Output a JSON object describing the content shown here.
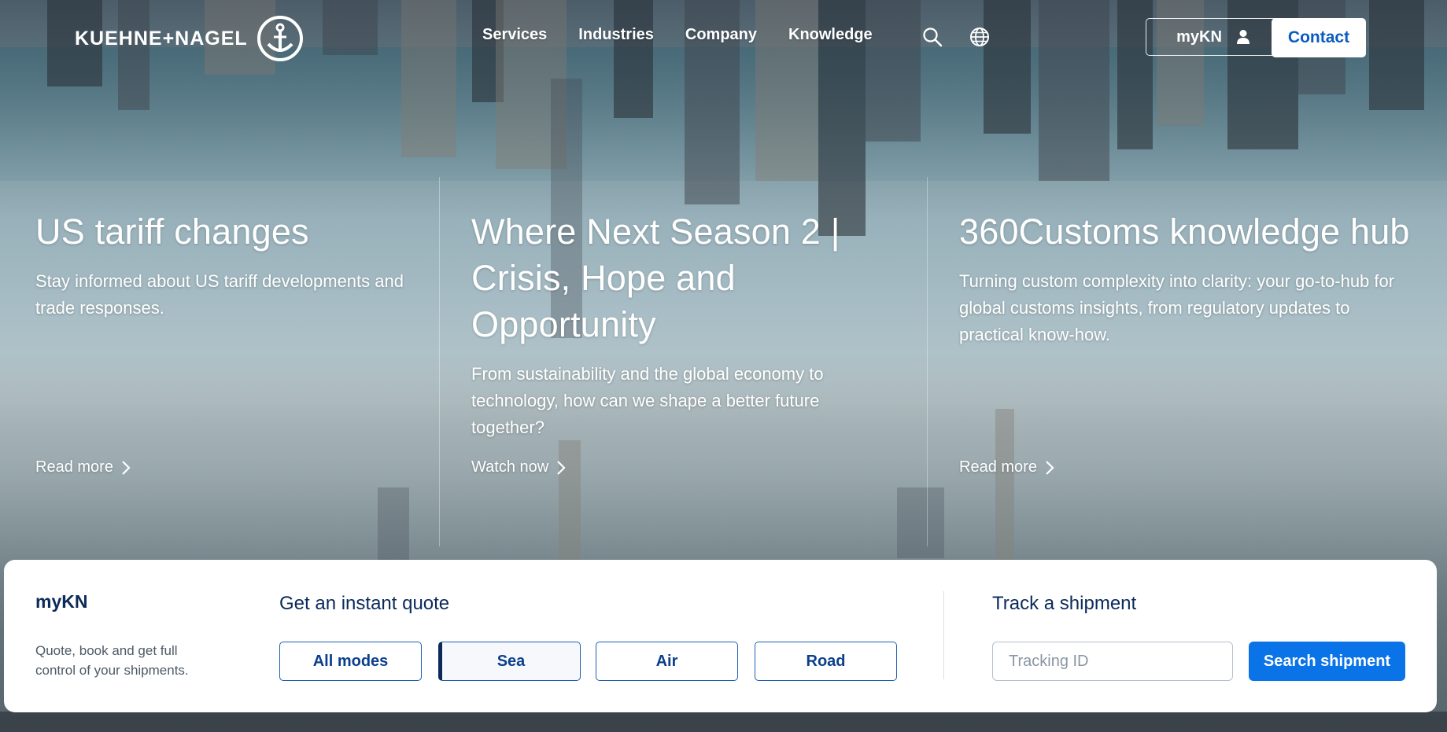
{
  "header": {
    "logo_text": "KUEHNE+NAGEL",
    "nav": [
      "Services",
      "Industries",
      "Company",
      "Knowledge"
    ],
    "search_icon": "search-icon",
    "globe_icon": "globe-icon",
    "mykn_label": "myKN",
    "user_icon": "user-icon",
    "contact_label": "Contact"
  },
  "hero": {
    "columns": [
      {
        "title": "US tariff changes",
        "description": "Stay informed about US tariff developments and trade responses.",
        "cta": "Read more"
      },
      {
        "title": "Where Next Season 2 | Crisis, Hope and Opportunity",
        "description": "From sustainability and the global economy to technology, how can we shape a better future together?",
        "cta": "Watch now"
      },
      {
        "title": "360Customs knowledge hub",
        "description": "Turning custom complexity into clarity: your go-to-hub for global customs insights, from regulatory updates to practical know-how.",
        "cta": "Read more"
      }
    ]
  },
  "panel": {
    "mykn_title": "myKN",
    "mykn_description": "Quote, book and get full control of your shipments.",
    "quote_title": "Get an instant quote",
    "modes": [
      "All modes",
      "Sea",
      "Air",
      "Road"
    ],
    "active_mode": "Sea",
    "track_title": "Track a shipment",
    "tracking_placeholder": "Tracking ID",
    "tracking_value": "",
    "search_label": "Search shipment"
  },
  "colors": {
    "brand_blue": "#0a5bbf",
    "navy": "#0b2a5a",
    "cta_blue": "#0a73e8"
  }
}
